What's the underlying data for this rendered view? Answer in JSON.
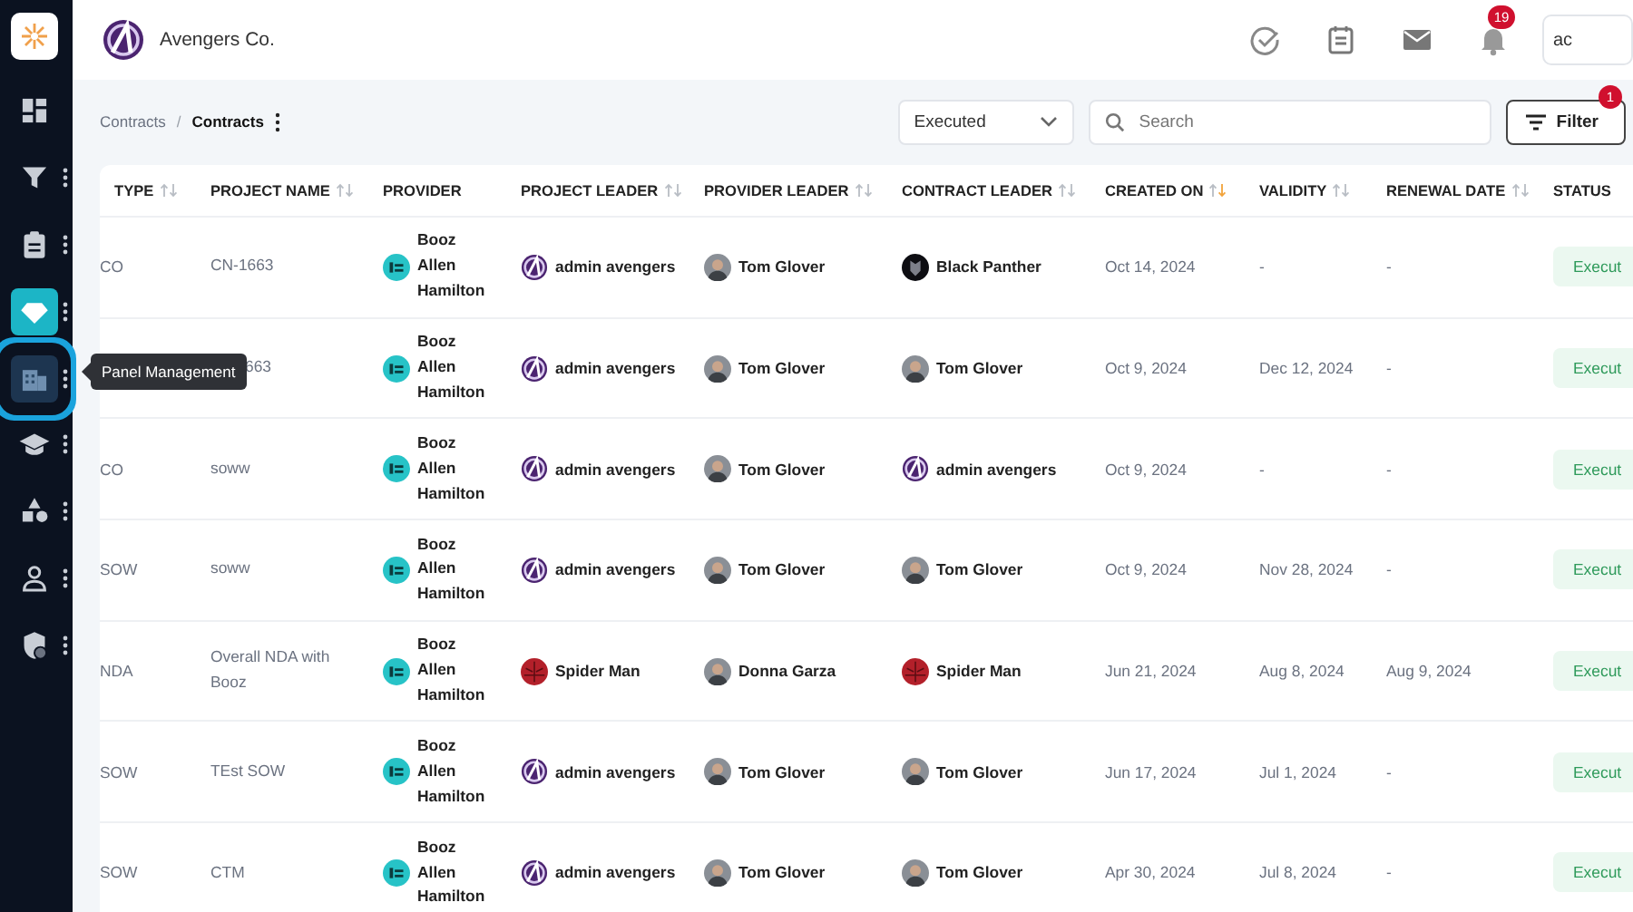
{
  "header": {
    "company": "Avengers Co.",
    "notifications": "19",
    "user": "ac"
  },
  "sidebar": {
    "tooltip": "Panel Management",
    "items": [
      {
        "selected": false,
        "hovered": false,
        "menu": false
      },
      {
        "selected": false,
        "hovered": false,
        "menu": true
      },
      {
        "selected": false,
        "hovered": false,
        "menu": true
      },
      {
        "selected": true,
        "hovered": false,
        "menu": true
      },
      {
        "selected": false,
        "hovered": true,
        "menu": true
      },
      {
        "selected": false,
        "hovered": false,
        "menu": true
      },
      {
        "selected": false,
        "hovered": false,
        "menu": true
      },
      {
        "selected": false,
        "hovered": false,
        "menu": true
      },
      {
        "selected": false,
        "hovered": false,
        "menu": true
      }
    ]
  },
  "breadcrumb": {
    "items": [
      "Contracts",
      "Contracts"
    ],
    "separator": "/"
  },
  "toolbar": {
    "status": "Executed",
    "search_placeholder": "Search",
    "filter_label": "Filter",
    "filter_count": "1"
  },
  "table": {
    "columns": [
      {
        "label": "TYPE",
        "sortable": true,
        "sorted_desc": false
      },
      {
        "label": "PROJECT NAME",
        "sortable": true,
        "sorted_desc": false
      },
      {
        "label": "PROVIDER",
        "sortable": false
      },
      {
        "label": "PROJECT LEADER",
        "sortable": true,
        "sorted_desc": false
      },
      {
        "label": "PROVIDER LEADER",
        "sortable": true,
        "sorted_desc": false
      },
      {
        "label": "CONTRACT LEADER",
        "sortable": true,
        "sorted_desc": false
      },
      {
        "label": "CREATED ON",
        "sortable": true,
        "sorted_desc": true
      },
      {
        "label": "VALIDITY",
        "sortable": true,
        "sorted_desc": false
      },
      {
        "label": "RENEWAL DATE",
        "sortable": true,
        "sorted_desc": false
      },
      {
        "label": "STATUS",
        "sortable": false
      }
    ],
    "rows": [
      {
        "type": "CO",
        "project_name": "CN-1663",
        "covered": false,
        "provider": "Booz Allen Hamilton",
        "project_leader": {
          "name": "admin avengers",
          "kind": "avengers"
        },
        "provider_leader": {
          "name": "Tom Glover",
          "kind": "photo"
        },
        "contract_leader": {
          "name": "Black Panther",
          "kind": "panther"
        },
        "created_on": "Oct 14, 2024",
        "validity": "-",
        "renewal_date": "-",
        "status": "Execut"
      },
      {
        "project_name": "663",
        "covered": true,
        "provider": "Booz Allen Hamilton",
        "project_leader": {
          "name": "admin avengers",
          "kind": "avengers"
        },
        "provider_leader": {
          "name": "Tom Glover",
          "kind": "photo"
        },
        "contract_leader": {
          "name": "Tom Glover",
          "kind": "photo"
        },
        "created_on": "Oct 9, 2024",
        "validity": "Dec 12, 2024",
        "renewal_date": "-",
        "status": "Execut"
      },
      {
        "type": "CO",
        "project_name": "soww",
        "covered": false,
        "provider": "Booz Allen Hamilton",
        "project_leader": {
          "name": "admin avengers",
          "kind": "avengers"
        },
        "provider_leader": {
          "name": "Tom Glover",
          "kind": "photo"
        },
        "contract_leader": {
          "name": "admin avengers",
          "kind": "avengers"
        },
        "created_on": "Oct 9, 2024",
        "validity": "-",
        "renewal_date": "-",
        "status": "Execut"
      },
      {
        "type": "SOW",
        "project_name": "soww",
        "covered": false,
        "provider": "Booz Allen Hamilton",
        "project_leader": {
          "name": "admin avengers",
          "kind": "avengers"
        },
        "provider_leader": {
          "name": "Tom Glover",
          "kind": "photo"
        },
        "contract_leader": {
          "name": "Tom Glover",
          "kind": "photo"
        },
        "created_on": "Oct 9, 2024",
        "validity": "Nov 28, 2024",
        "renewal_date": "-",
        "status": "Execut"
      },
      {
        "type": "NDA",
        "project_name": "Overall NDA with Booz",
        "covered": false,
        "provider": "Booz Allen Hamilton",
        "project_leader": {
          "name": "Spider Man",
          "kind": "spider"
        },
        "provider_leader": {
          "name": "Donna Garza",
          "kind": "photo"
        },
        "contract_leader": {
          "name": "Spider Man",
          "kind": "spider"
        },
        "created_on": "Jun 21, 2024",
        "validity": "Aug 8, 2024",
        "renewal_date": "Aug 9, 2024",
        "status": "Execut"
      },
      {
        "type": "SOW",
        "project_name": "TEst SOW",
        "covered": false,
        "provider": "Booz Allen Hamilton",
        "project_leader": {
          "name": "admin avengers",
          "kind": "avengers"
        },
        "provider_leader": {
          "name": "Tom Glover",
          "kind": "photo"
        },
        "contract_leader": {
          "name": "Tom Glover",
          "kind": "photo"
        },
        "created_on": "Jun 17, 2024",
        "validity": "Jul 1, 2024",
        "renewal_date": "-",
        "status": "Execut"
      },
      {
        "type": "SOW",
        "project_name": "CTM",
        "covered": false,
        "provider": "Booz Allen Hamilton",
        "project_leader": {
          "name": "admin avengers",
          "kind": "avengers"
        },
        "provider_leader": {
          "name": "Tom Glover",
          "kind": "photo"
        },
        "contract_leader": {
          "name": "Tom Glover",
          "kind": "photo"
        },
        "created_on": "Apr 30, 2024",
        "validity": "Jul 8, 2024",
        "renewal_date": "-",
        "status": "Execut"
      }
    ]
  }
}
